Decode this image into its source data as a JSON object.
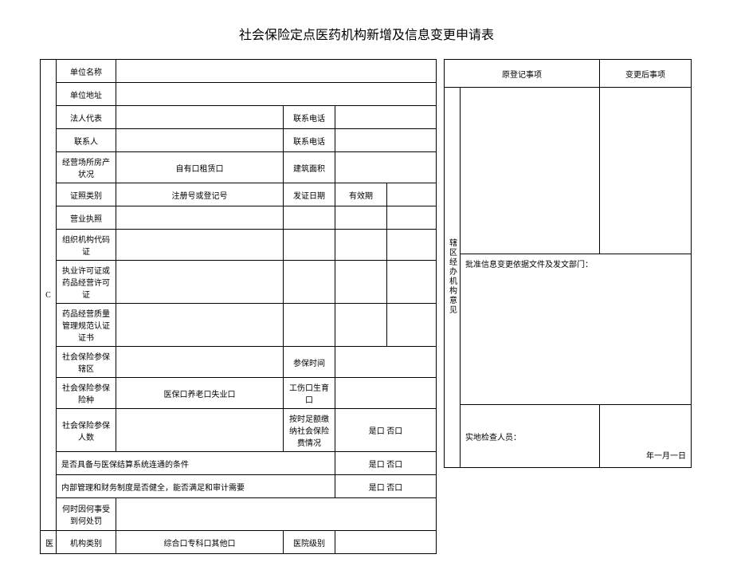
{
  "title": "社会保险定点医药机构新增及信息变更申请表",
  "left_side_c": "C",
  "left_side_med": "医",
  "labels": {
    "unit_name": "单位名称",
    "unit_addr": "单位地址",
    "legal_rep": "法人代表",
    "contact_phone": "联系电话",
    "contact_person": "联系人",
    "property_status": "经营场所房产状况",
    "own_rent": "自有口租赁口",
    "build_area": "建筑面积",
    "license_type": "证照类别",
    "reg_no": "注册号或登记号",
    "issue_date": "发证日期",
    "valid_period": "有效期",
    "biz_license": "营业执照",
    "org_code": "组织机构代码证",
    "practice_license": "执业许可证或药品经营许可证",
    "gsp_cert": "药品经营质量管理规范认证证书",
    "si_area": "社会保险参保辖区",
    "insure_time": "参保时间",
    "si_types": "社会保险参保险种",
    "si_types_val": "医保口养老口失业口",
    "injury_birth": "工伤口生育口",
    "si_count": "社会保险参保人数",
    "full_pay": "按时足额缴纳社会保险费情况",
    "yes_no": "是口 否口",
    "yes_no2": "是口  否口",
    "settle_cond": "是否具备与医保结算系统连通的条件",
    "internal_mgmt": "内部管理和财务制度是否健全，能否满足和审计需要",
    "penalty": "何时因何事受到何处罚",
    "inst_type": "机构类别",
    "inst_type_val": "综合口专科口其他口",
    "hospital_level": "医院级别"
  },
  "right": {
    "orig_items": "原登记事项",
    "changed_items": "变更后事项",
    "approval_basis": "批准信息变更依据文件及发文部门：",
    "district_opinion": "辖区经办机构意见",
    "inspector": "实地检查人员：",
    "date": "年一月一日"
  }
}
